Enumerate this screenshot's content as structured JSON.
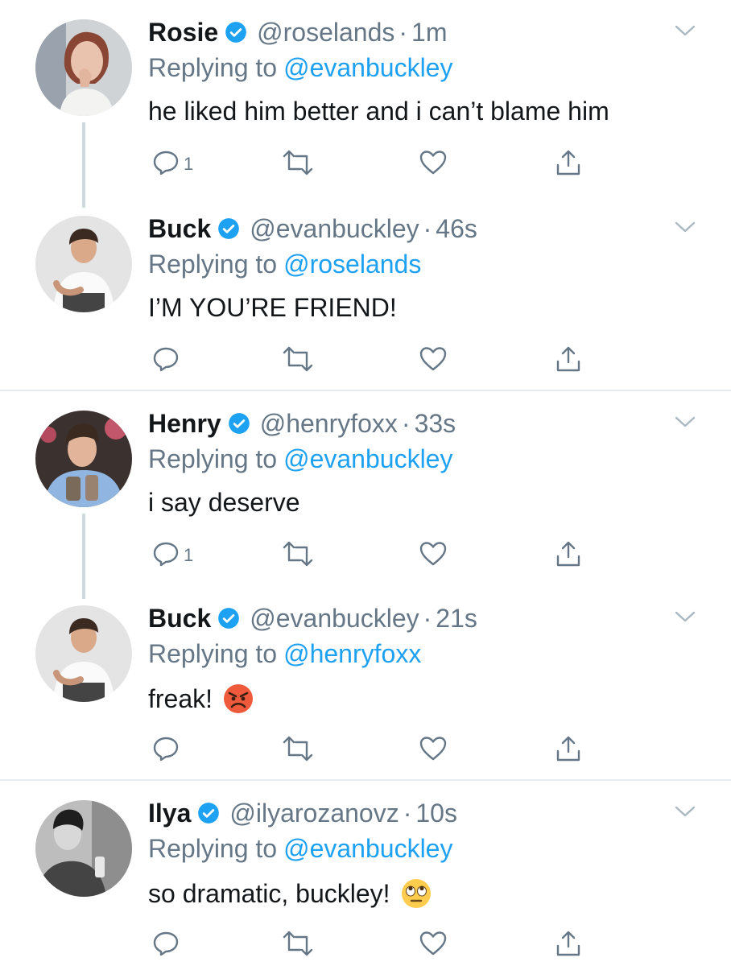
{
  "tweets": [
    {
      "name": "Rosie",
      "handle": "@roselands",
      "dot": "·",
      "time": "1m",
      "replying_label": "Replying to",
      "replying_to": "@evanbuckley",
      "text": "he liked him better and i can’t blame him",
      "reply_count": "1",
      "avatar_icon": "woman-portrait-avatar"
    },
    {
      "name": "Buck",
      "handle": "@evanbuckley",
      "dot": "·",
      "time": "46s",
      "replying_label": "Replying to",
      "replying_to": "@roselands",
      "text": "I’M YOU’RE FRIEND!",
      "reply_count": "",
      "avatar_icon": "man-white-shirt-avatar"
    },
    {
      "name": "Henry",
      "handle": "@henryfoxx",
      "dot": "·",
      "time": "33s",
      "replying_label": "Replying to",
      "replying_to": "@evanbuckley",
      "text": "i say deserve",
      "reply_count": "1",
      "avatar_icon": "man-blue-shirt-avatar"
    },
    {
      "name": "Buck",
      "handle": "@evanbuckley",
      "dot": "·",
      "time": "21s",
      "replying_label": "Replying to",
      "replying_to": "@henryfoxx",
      "text": "freak!",
      "reply_count": "",
      "emoji": "angry-face-emoji",
      "avatar_icon": "man-white-shirt-avatar"
    },
    {
      "name": "Ilya",
      "handle": "@ilyarozanovz",
      "dot": "·",
      "time": "10s",
      "replying_label": "Replying to",
      "replying_to": "@evanbuckley",
      "text": "so dramatic, buckley!",
      "reply_count": "",
      "emoji": "rolling-eyes-emoji",
      "avatar_icon": "man-black-white-avatar"
    }
  ],
  "icons": [
    "verified-badge-icon",
    "chevron-down-icon",
    "reply-icon",
    "retweet-icon",
    "like-icon",
    "share-icon"
  ],
  "colors": {
    "accent": "#1da1f2",
    "secondary_text": "#657786",
    "primary_text": "#14171a",
    "divider": "#e6ecf0",
    "thread_line": "#cfd9de"
  }
}
